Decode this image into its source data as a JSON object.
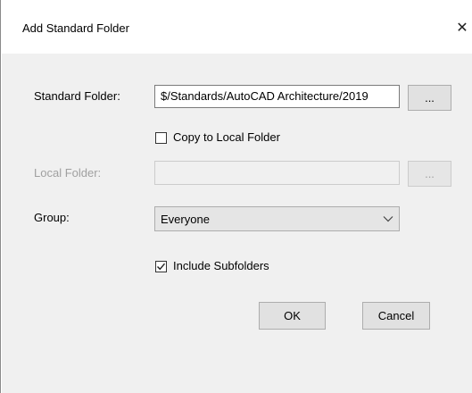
{
  "dialog": {
    "title": "Add Standard Folder",
    "close_glyph": "✕"
  },
  "form": {
    "standard_folder_label": "Standard Folder:",
    "standard_folder_value": "$/Standards/AutoCAD Architecture/2019",
    "browse_label": "...",
    "copy_to_local_label": "Copy to Local Folder",
    "copy_to_local_checked": false,
    "local_folder_label": "Local Folder:",
    "local_folder_value": "",
    "local_browse_label": "...",
    "group_label": "Group:",
    "group_value": "Everyone",
    "include_subfolders_label": "Include Subfolders",
    "include_subfolders_checked": true
  },
  "buttons": {
    "ok_label": "OK",
    "cancel_label": "Cancel"
  },
  "icons": {
    "close": "close-icon",
    "dropdown": "chevron-down-icon",
    "check": "checkmark-icon"
  }
}
